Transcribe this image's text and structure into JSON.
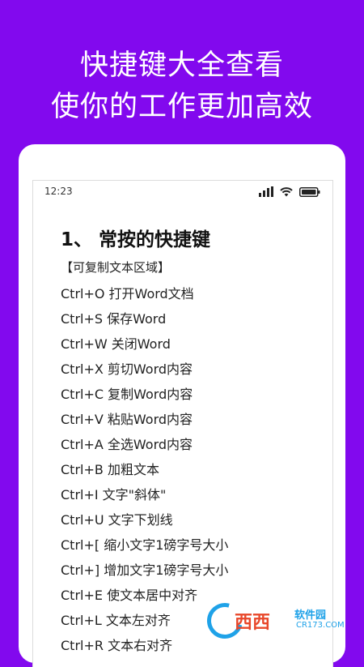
{
  "headline": {
    "line1": "快捷键大全查看",
    "line2": "使你的工作更加高效"
  },
  "status_bar": {
    "time": "12:23"
  },
  "content": {
    "section_title": "1、 常按的快捷键",
    "copy_hint": "【可复制文本区域】",
    "shortcuts": [
      "Ctrl+O 打开Word文档",
      "Ctrl+S 保存Word",
      "Ctrl+W 关闭Word",
      "Ctrl+X 剪切Word内容",
      "Ctrl+C 复制Word内容",
      "Ctrl+V 粘贴Word内容",
      "Ctrl+A 全选Word内容",
      "Ctrl+B 加粗文本",
      "Ctrl+I 文字\"斜体\"",
      "Ctrl+U 文字下划线",
      "Ctrl+[ 缩小文字1磅字号大小",
      "Ctrl+] 增加文字1磅字号大小",
      "Ctrl+E 使文本居中对齐",
      "Ctrl+L 文本左对齐",
      "Ctrl+R 文本右对齐"
    ]
  },
  "watermark": {
    "brand": "西西",
    "sub": "软件园",
    "url": "CR173.COM"
  },
  "colors": {
    "background": "#8209ee",
    "card": "#ffffff",
    "text": "#222222"
  }
}
